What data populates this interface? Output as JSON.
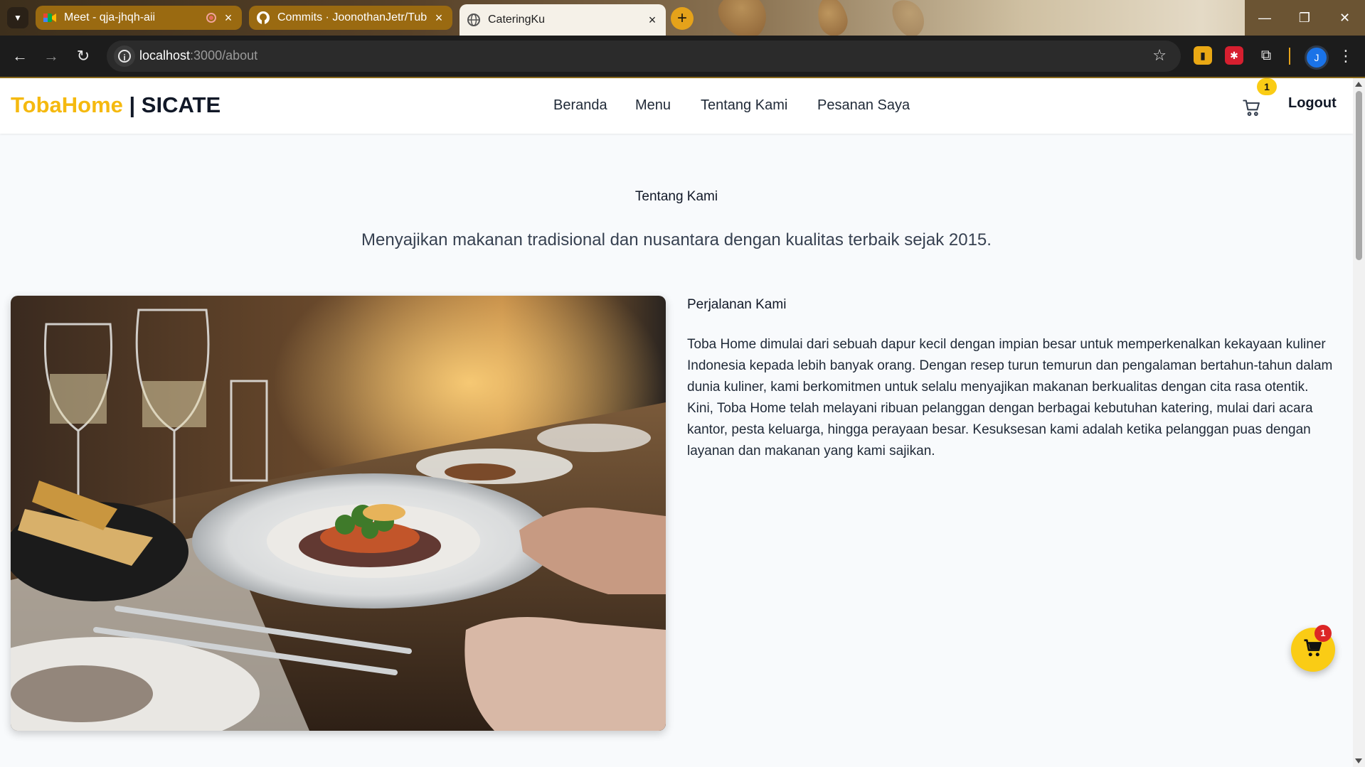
{
  "browser": {
    "tabs": [
      {
        "title": "Meet - qja-jhqh-aii",
        "active": false
      },
      {
        "title": "Commits · JoonothanJetr/Tubes",
        "active": false
      },
      {
        "title": "CateringKu",
        "active": true
      }
    ],
    "url_host": "localhost",
    "url_path": ":3000/about",
    "profile_initial": "J",
    "accent_color": "#e5a21a"
  },
  "site": {
    "brand_part1": "TobaHome",
    "brand_separator": " | ",
    "brand_part2": "SICATE",
    "nav": [
      "Beranda",
      "Menu",
      "Tentang Kami",
      "Pesanan Saya"
    ],
    "cart_count": "1",
    "logout_label": "Logout",
    "brand_color": "#f5b90f"
  },
  "about": {
    "label": "Tentang Kami",
    "tagline": "Menyajikan makanan tradisional dan nusantara dengan kualitas terbaik sejak 2015.",
    "journey_title": "Perjalanan Kami",
    "paragraphs": [
      "Toba Home dimulai dari sebuah dapur kecil dengan impian besar untuk memperkenalkan kekayaan kuliner Indonesia kepada lebih banyak orang. Dengan resep turun temurun dan pengalaman bertahun-tahun dalam dunia kuliner, kami berkomitmen untuk selalu menyajikan makanan berkualitas dengan cita rasa otentik.",
      "Kini, Toba Home telah melayani ribuan pelanggan dengan berbagai kebutuhan katering, mulai dari acara kantor, pesta keluarga, hingga perayaan besar. Kesuksesan kami adalah ketika pelanggan puas dengan layanan dan makanan yang kami sajikan."
    ]
  },
  "floating_cart": {
    "count": "1"
  }
}
